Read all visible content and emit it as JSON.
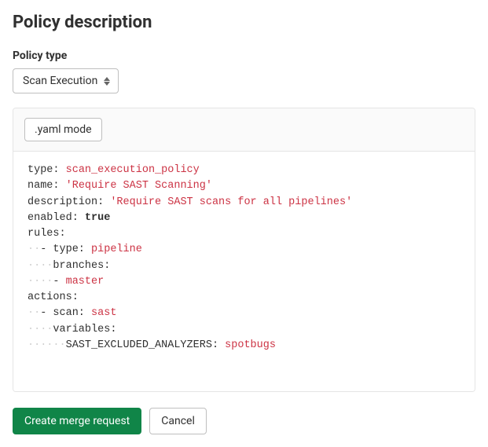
{
  "page": {
    "title": "Policy description"
  },
  "form": {
    "policyTypeLabel": "Policy type",
    "policyTypeValue": "Scan Execution"
  },
  "editor": {
    "modeLabel": ".yaml mode",
    "lines": [
      {
        "segments": [
          {
            "cls": "k",
            "t": "type:"
          },
          {
            "cls": "plain",
            "t": " "
          },
          {
            "cls": "v-ident",
            "t": "scan_execution_policy"
          }
        ]
      },
      {
        "segments": [
          {
            "cls": "k",
            "t": "name:"
          },
          {
            "cls": "plain",
            "t": " "
          },
          {
            "cls": "v-str",
            "t": "'Require SAST Scanning'"
          }
        ]
      },
      {
        "segments": [
          {
            "cls": "k",
            "t": "description:"
          },
          {
            "cls": "plain",
            "t": " "
          },
          {
            "cls": "v-str",
            "t": "'Require SAST scans for all pipelines'"
          }
        ]
      },
      {
        "segments": [
          {
            "cls": "k",
            "t": "enabled:"
          },
          {
            "cls": "plain",
            "t": " "
          },
          {
            "cls": "v-bool",
            "t": "true"
          }
        ]
      },
      {
        "segments": [
          {
            "cls": "k",
            "t": "rules:"
          }
        ]
      },
      {
        "segments": [
          {
            "cls": "ws",
            "t": "··"
          },
          {
            "cls": "plain",
            "t": "- "
          },
          {
            "cls": "k",
            "t": "type:"
          },
          {
            "cls": "plain",
            "t": " "
          },
          {
            "cls": "v-ident",
            "t": "pipeline"
          }
        ]
      },
      {
        "segments": [
          {
            "cls": "ws",
            "t": "····"
          },
          {
            "cls": "k",
            "t": "branches:"
          }
        ]
      },
      {
        "segments": [
          {
            "cls": "ws",
            "t": "····"
          },
          {
            "cls": "plain",
            "t": "- "
          },
          {
            "cls": "v-ident",
            "t": "master"
          }
        ]
      },
      {
        "segments": [
          {
            "cls": "k",
            "t": "actions:"
          }
        ]
      },
      {
        "segments": [
          {
            "cls": "ws",
            "t": "··"
          },
          {
            "cls": "plain",
            "t": "- "
          },
          {
            "cls": "k",
            "t": "scan:"
          },
          {
            "cls": "plain",
            "t": " "
          },
          {
            "cls": "v-ident",
            "t": "sast"
          }
        ]
      },
      {
        "segments": [
          {
            "cls": "ws",
            "t": "····"
          },
          {
            "cls": "k",
            "t": "variables:"
          }
        ]
      },
      {
        "segments": [
          {
            "cls": "ws",
            "t": "······"
          },
          {
            "cls": "k",
            "t": "SAST_EXCLUDED_ANALYZERS:"
          },
          {
            "cls": "plain",
            "t": " "
          },
          {
            "cls": "v-ident",
            "t": "spotbugs"
          }
        ]
      }
    ]
  },
  "actions": {
    "primary": "Create merge request",
    "secondary": "Cancel"
  }
}
